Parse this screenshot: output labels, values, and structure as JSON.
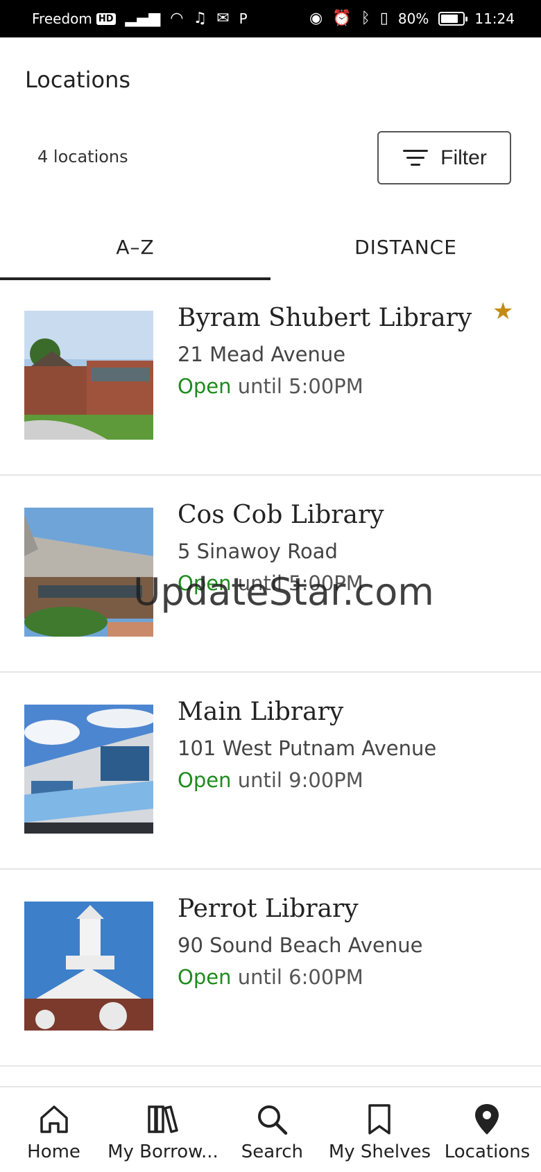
{
  "status_bar": {
    "carrier": "Freedom",
    "carrier_badge": "HD",
    "extra": "P",
    "battery_percent": "80%",
    "battery_level": 0.8,
    "time": "11:24"
  },
  "header": {
    "title": "Locations",
    "count": "4 locations",
    "filter_label": "Filter"
  },
  "tabs": [
    {
      "label": "A–Z",
      "active": true
    },
    {
      "label": "DISTANCE",
      "active": false
    }
  ],
  "locations": [
    {
      "name": "Byram Shubert Library",
      "address": "21 Mead Avenue",
      "status": "Open",
      "hours": "until 5:00PM",
      "favorite": true
    },
    {
      "name": "Cos Cob Library",
      "address": "5 Sinawoy Road",
      "status": "Open",
      "hours": "until 5:00PM",
      "favorite": false
    },
    {
      "name": "Main Library",
      "address": "101 West Putnam Avenue",
      "status": "Open",
      "hours": "until 9:00PM",
      "favorite": false
    },
    {
      "name": "Perrot Library",
      "address": "90 Sound Beach Avenue",
      "status": "Open",
      "hours": "until 6:00PM",
      "favorite": false
    }
  ],
  "watermark": "UpdateStar.com",
  "bottom_nav": [
    {
      "label": "Home",
      "icon": "home-icon"
    },
    {
      "label": "My Borrow...",
      "icon": "books-icon"
    },
    {
      "label": "Search",
      "icon": "search-icon"
    },
    {
      "label": "My Shelves",
      "icon": "bookmark-icon"
    },
    {
      "label": "Locations",
      "icon": "location-pin-icon"
    }
  ],
  "colors": {
    "open_status": "#1e8a1e",
    "favorite_star": "#c48a12"
  }
}
